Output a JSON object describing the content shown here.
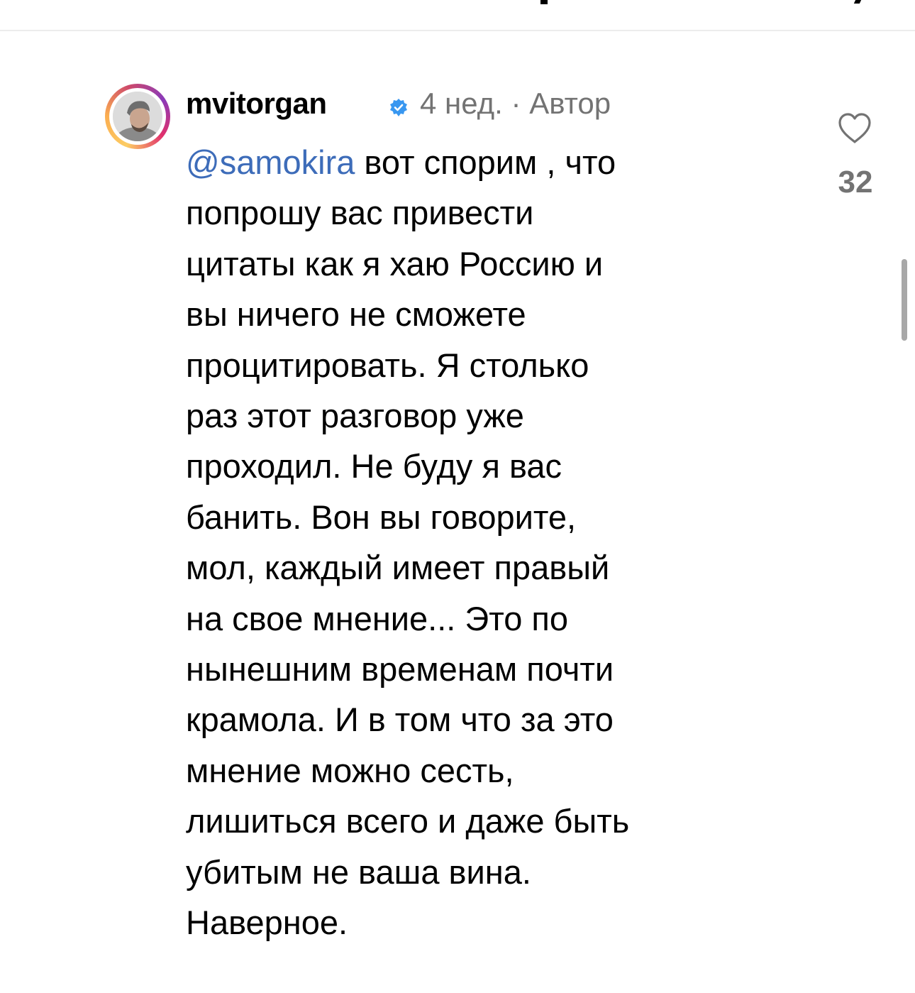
{
  "comment": {
    "username": "mvitorgan",
    "verified": true,
    "timestamp": "4 нед.",
    "separator": "·",
    "author_tag": "Автор",
    "mention": "@samokira",
    "text": " вот спорим , что\nпопрошу вас привести\nцитаты как я хаю Россию и\nвы ничего не сможете\nпроцитировать. Я столько\nраз этот разговор уже\nпроходил. Не буду я вас\nбанить. Вон вы говорите,\nмол, каждый имеет правый\nна свое мнение... Это по\nнынешним временам почти\nкрамола. И в том что за это\nмнение можно сесть,\nлишиться всего и даже быть\nубитым не ваша вина.\nНаверное.",
    "like_count": "32"
  },
  "icons": {
    "like": "heart-outline-icon",
    "verified": "verified-badge-icon"
  },
  "colors": {
    "mention": "#3d6cb9",
    "meta": "#737373",
    "verified": "#3897f0"
  }
}
